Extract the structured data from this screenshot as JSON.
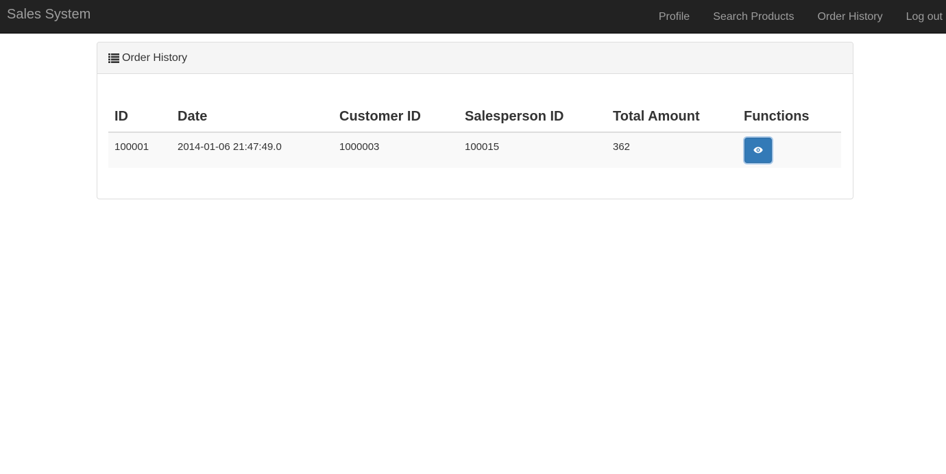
{
  "navbar": {
    "brand": "Sales System",
    "links": [
      "Profile",
      "Search Products",
      "Order History",
      "Log out"
    ]
  },
  "panel": {
    "title": "Order History",
    "icon": "list-icon"
  },
  "table": {
    "headers": [
      "ID",
      "Date",
      "Customer ID",
      "Salesperson ID",
      "Total Amount",
      "Functions"
    ],
    "rows": [
      {
        "id": "100001",
        "date": "2014-01-06 21:47:49.0",
        "customer_id": "1000003",
        "salesperson_id": "100015",
        "total_amount": "362",
        "action_icon": "eye-icon"
      }
    ]
  },
  "colors": {
    "navbar_bg": "#222222",
    "nav_text": "#9d9d9d",
    "primary_button": "#337ab7"
  }
}
